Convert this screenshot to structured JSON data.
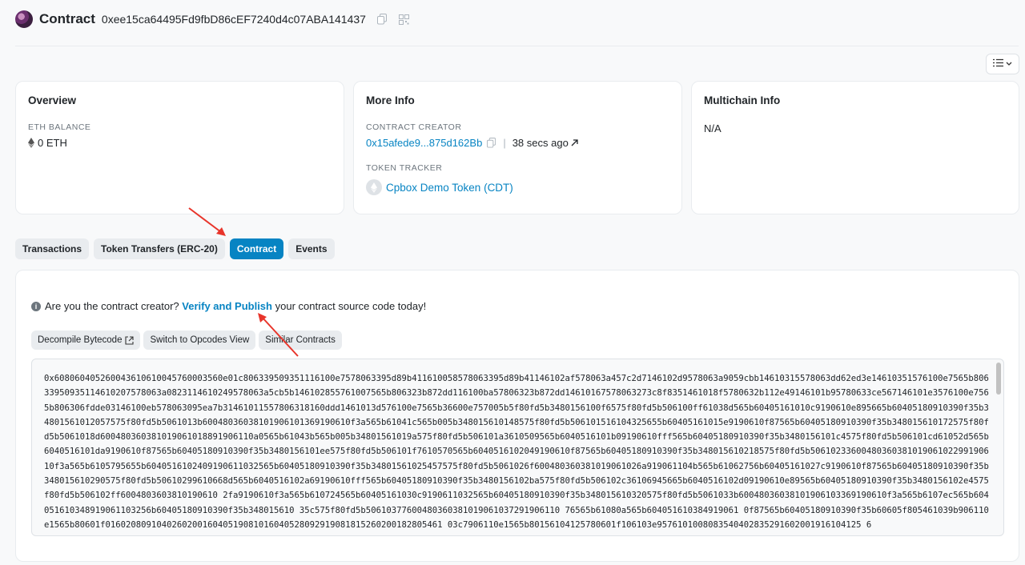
{
  "header": {
    "title": "Contract",
    "address": "0xee15ca64495Fd9fbD86cEF7240d4c07ABA141437",
    "copy_icon": "copy-icon",
    "qr_icon": "qr-icon"
  },
  "view_toggle": {
    "icon": "list-view-icon",
    "chevron": "chevron-down-icon"
  },
  "overview": {
    "title": "Overview",
    "balance_label": "ETH BALANCE",
    "balance_value": "0 ETH"
  },
  "more_info": {
    "title": "More Info",
    "creator_label": "CONTRACT CREATOR",
    "creator_address": "0x15afede9...875d162Bb",
    "separator": "|",
    "creator_time": "38 secs ago",
    "token_label": "TOKEN TRACKER",
    "token_name": "Cpbox Demo Token (CDT)"
  },
  "multichain": {
    "title": "Multichain Info",
    "value": "N/A"
  },
  "tabs": [
    {
      "label": "Transactions",
      "active": false
    },
    {
      "label": "Token Transfers (ERC-20)",
      "active": false
    },
    {
      "label": "Contract",
      "active": true
    },
    {
      "label": "Events",
      "active": false
    }
  ],
  "contract": {
    "notice_prefix": "Are you the contract creator?",
    "notice_link": "Verify and Publish",
    "notice_suffix": "your contract source code today!",
    "buttons": {
      "decompile": "Decompile Bytecode",
      "opcodes": "Switch to Opcodes View",
      "similar": "Similar Contracts"
    },
    "bytecode": "0x608060405260043610610045760003560e01c806339509351116100e7578063395d89b411610058578063395d89b41146102af578063a457c2d7146102d9578063a9059cbb14610315578063dd62ed3e14610351576100e7565b80633950935114610207578063a0823114610249578063a5cb5b146102855761007565b806323b872dd116100ba57806323b872dd14610167578063273c8f8351461018f5780632b112e49146101b95780633ce567146101e3576100e7565b806306fdde03146100eb578063095ea7b31461011557806318160ddd1461013d576100e7565b36600e757005b5f80fd5b3480156100f6575f80fd5b506100ff61038d565b60405161010c9190610e895665b60405180910390f35b34801561012057575f80fd5b5061013b60048036038101906101369190610f3a565b61041c565b005b348015610148575f80fd5b506101516104325655b60405161015e9190610f87565b60405180910390f35b348015610172575f80fd5b5061018d600480360381019061018891906110a0565b61043b565b005b34801561019a575f80fd5b506101a3610509565b6040516101b09190610fff565b60405180910390f35b3480156101c4575f80fd5b506101cd61052d565b6040516101da9190610f87565b60405180910390f35b3480156101ee575f80fd5b506101f7610570565b6040516102049190610f87565b60405180910390f35b348015610218575f80fd5b5061023360048036038101906102299190610f3a565b6105795655b6040516102409190611032565b60405180910390f35b34801561025457575f80fd5b5061026f600480360381019061026a919061104b565b61062756b60405161027c9190610f87565b60405180910390f35b348015610290575f80fd5b50610299610668d565b6040516102a69190610fff565b60405180910390f35b3480156102ba575f80fd5b506102c36106945665b6040516102d09190610e89565b60405180910390f35b3480156102e4575f80fd5b506102ff6004803603810190610 2fa9190610f3a565b610724565b60405161030c9190611032565b60405180910390f35b348015610320575f80fd5b5061033b60048036038101906103369190610f3a565b6107ec565b604051610348919061103256b60405180910390f35b348015610 35c575f80fd5b50610377600480360381019061037291906110 76565b61080a565b604051610384919061 0f87565b60405180910390f35b60605f805461039b906110e1565b80601f016020809104026020016040519081016040528092919081815260200182805461 03c7906110e1565b80156104125780601f106103e9576101008083540402835291602001916104125 6"
  },
  "annotations": {
    "arrow_color": "#e8352b"
  }
}
